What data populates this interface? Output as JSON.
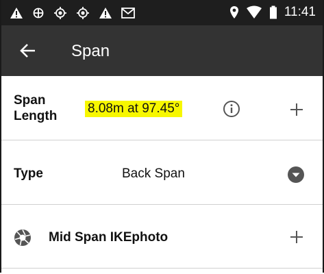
{
  "status_bar": {
    "time": "11:41",
    "left_icons": [
      "warning-icon",
      "gps-crosshair-icon",
      "location-target-icon",
      "location-target-icon",
      "warning-icon",
      "gmail-icon"
    ],
    "right_icons": [
      "location-pin-icon",
      "wifi-icon",
      "battery-icon"
    ]
  },
  "app_bar": {
    "title": "Span",
    "back_icon": "arrow-left-icon"
  },
  "rows": {
    "span_length": {
      "label": "Span Length",
      "value": "8.08m at 97.45°",
      "highlight_color": "#f7f700"
    },
    "type": {
      "label": "Type",
      "value": "Back Span"
    },
    "mid_span_photo": {
      "label": "Mid Span IKEphoto"
    }
  },
  "colors": {
    "status_bar_bg": "#1e1e1e",
    "app_bar_bg": "#333333",
    "divider": "#d0d0d0",
    "icon_gray": "#555555"
  }
}
